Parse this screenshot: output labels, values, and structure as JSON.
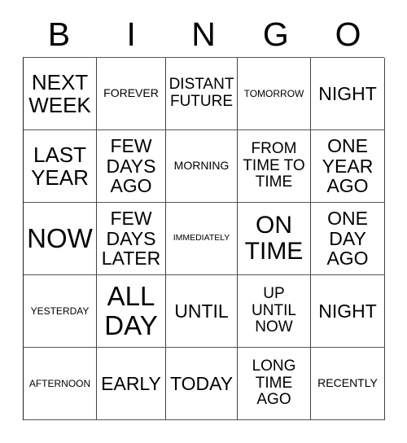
{
  "header": {
    "letters": [
      "B",
      "I",
      "N",
      "G",
      "O"
    ]
  },
  "grid": {
    "rows": 5,
    "columns": 5,
    "border_color": "#444444",
    "background_color": "#ffffff",
    "text_color": "#000000",
    "cells": [
      {
        "text": "NEXT\nWEEK",
        "size": "lg"
      },
      {
        "text": "FOREVER",
        "size": "xs"
      },
      {
        "text": "DISTANT\nFUTURE",
        "size": "sm"
      },
      {
        "text": "TOMORROW",
        "size": "xxs"
      },
      {
        "text": "NIGHT",
        "size": "md"
      },
      {
        "text": "LAST\nYEAR",
        "size": "lg"
      },
      {
        "text": "FEW\nDAYS\nAGO",
        "size": "md"
      },
      {
        "text": "MORNING",
        "size": "xs"
      },
      {
        "text": "FROM\nTIME TO\nTIME",
        "size": "sm"
      },
      {
        "text": "ONE\nYEAR\nAGO",
        "size": "md"
      },
      {
        "text": "NOW",
        "size": "xxl"
      },
      {
        "text": "FEW\nDAYS\nLATER",
        "size": "md"
      },
      {
        "text": "IMMEDIATELY",
        "size": "tiny"
      },
      {
        "text": "ON\nTIME",
        "size": "xl"
      },
      {
        "text": "ONE\nDAY\nAGO",
        "size": "md"
      },
      {
        "text": "YESTERDAY",
        "size": "xxs"
      },
      {
        "text": "ALL\nDAY",
        "size": "xxl"
      },
      {
        "text": "UNTIL",
        "size": "md"
      },
      {
        "text": "UP\nUNTIL\nNOW",
        "size": "sm"
      },
      {
        "text": "NIGHT",
        "size": "md"
      },
      {
        "text": "AFTERNOON",
        "size": "xxs"
      },
      {
        "text": "EARLY",
        "size": "md"
      },
      {
        "text": "TODAY",
        "size": "md"
      },
      {
        "text": "LONG\nTIME\nAGO",
        "size": "sm"
      },
      {
        "text": "RECENTLY",
        "size": "xs"
      }
    ]
  }
}
